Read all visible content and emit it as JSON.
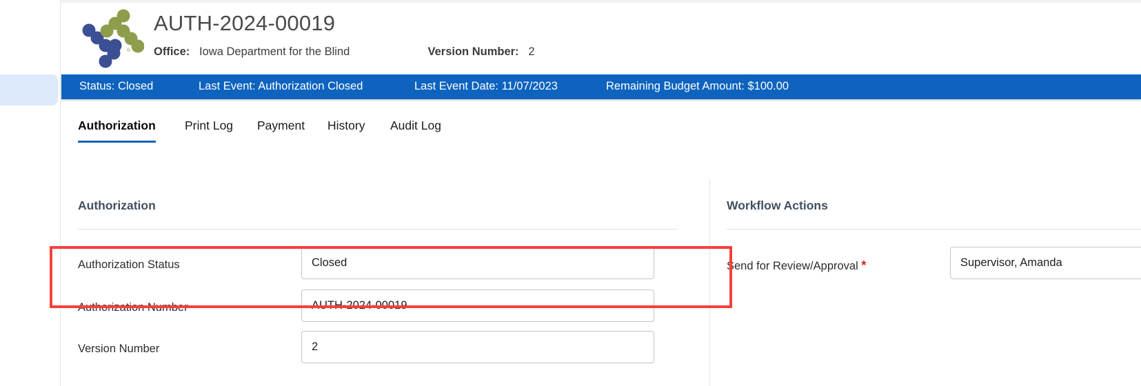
{
  "record": {
    "title": "AUTH-2024-00019",
    "office_label": "Office:",
    "office_value": "Iowa Department for the Blind",
    "version_label": "Version Number:",
    "version_value": "2",
    "logo_name": "company-logo"
  },
  "status_bar": {
    "status": "Status: Closed",
    "last_event": "Last Event: Authorization Closed",
    "last_event_date": "Last Event Date: 11/07/2023",
    "remaining_budget": "Remaining Budget Amount: $100.00",
    "background_color": "#0d63bd"
  },
  "tabs": [
    {
      "label": "Authorization",
      "active": true
    },
    {
      "label": "Print Log",
      "active": false
    },
    {
      "label": "Payment",
      "active": false
    },
    {
      "label": "History",
      "active": false
    },
    {
      "label": "Audit Log",
      "active": false
    }
  ],
  "authorization_section": {
    "title": "Authorization",
    "fields": [
      {
        "label": "Authorization Status",
        "value": "Closed"
      },
      {
        "label": "Authorization Number",
        "value": "AUTH-2024-00019"
      },
      {
        "label": "Version Number",
        "value": "2"
      }
    ]
  },
  "workflow_section": {
    "title": "Workflow Actions",
    "field_label": "Send for Review/Approval",
    "required_marker": "*",
    "field_value": "Supervisor, Amanda"
  },
  "annotation": {
    "highlight_color": "#f4413c"
  },
  "sidebar": {
    "active_pill_color": "#ddeafb"
  }
}
